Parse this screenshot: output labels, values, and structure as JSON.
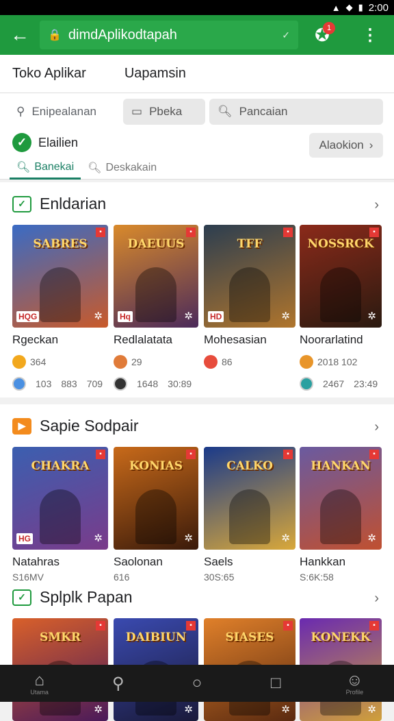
{
  "status": {
    "time": "2:00"
  },
  "appbar": {
    "url": "dimdAplikodtapah",
    "badge": "1"
  },
  "topnav": {
    "tabs": [
      "Toko Aplikar",
      "Uapamsin"
    ]
  },
  "filters": {
    "location": "Enipealanan",
    "category": "Pbeka",
    "search_placeholder": "Pancaian",
    "check_label": "Elailien",
    "all_button": "Alaokion",
    "tabs": [
      "Banekai",
      "Deskakain"
    ]
  },
  "sections": [
    {
      "title": "Enldarian",
      "cards": [
        {
          "art": "SABRES",
          "title": "Rgeckan",
          "meta1": "364",
          "meta2a": "103",
          "meta2b": "883",
          "meta2c": "709",
          "tag": "HQG",
          "colors": [
            "#3a6bc4",
            "#c95a2a"
          ],
          "dot1": "#f2a81d",
          "dot2": "#4a90e2"
        },
        {
          "art": "DAEUUS",
          "title": "Redlalatata",
          "meta1": "29",
          "meta2a": "1648",
          "meta2b": "30:89",
          "tag": "Hq",
          "colors": [
            "#d98a2b",
            "#4b2a5a"
          ],
          "dot1": "#e07b39",
          "dot2": "#333333"
        },
        {
          "art": "TFF",
          "title": "Mohesasian",
          "meta1": "86",
          "meta2a": "",
          "meta2b": "",
          "tag": "HD",
          "colors": [
            "#2c3e50",
            "#b0752c"
          ],
          "dot1": "#e74c3c",
          "dot2": "#ffffff"
        },
        {
          "art": "NOSSRCK",
          "title": "Noorarlatind",
          "meta1": "2018 102",
          "meta2a": "2467",
          "meta2b": "23:49",
          "tag": "",
          "colors": [
            "#8b2a1a",
            "#2a1a10"
          ],
          "dot1": "#e8952a",
          "dot2": "#2aa0a0"
        }
      ]
    },
    {
      "title": "Sapie Sodpair",
      "cards": [
        {
          "art": "CHAKRA",
          "title": "Natahras",
          "sub": "S16MV",
          "tag": "HG",
          "colors": [
            "#3b5fb0",
            "#7a3b8a"
          ]
        },
        {
          "art": "KONIAS",
          "title": "Saolonan",
          "sub": "616",
          "tag": "",
          "colors": [
            "#c86a1a",
            "#3a1a0a"
          ]
        },
        {
          "art": "CALKO",
          "title": "Saels",
          "sub": "30S:65",
          "tag": "",
          "colors": [
            "#1a3a8a",
            "#d9a83a"
          ]
        },
        {
          "art": "HANKAN",
          "title": "Hankkan",
          "sub": "S:6K:58",
          "tag": "",
          "colors": [
            "#6a5aa0",
            "#c05030"
          ]
        }
      ]
    },
    {
      "title": "Splplk Papan",
      "cards": [
        {
          "art": "SMKR",
          "colors": [
            "#d9602a",
            "#4a1a5a"
          ]
        },
        {
          "art": "DAIBIUN",
          "colors": [
            "#3a4ab0",
            "#1a1a3a"
          ]
        },
        {
          "art": "SIASES",
          "colors": [
            "#e0802a",
            "#5a2a10"
          ]
        },
        {
          "art": "KONEKK",
          "colors": [
            "#6a2ab0",
            "#d0a03a"
          ]
        }
      ]
    }
  ],
  "bottomnav": {
    "home": "Utama",
    "profile": "Profile"
  }
}
